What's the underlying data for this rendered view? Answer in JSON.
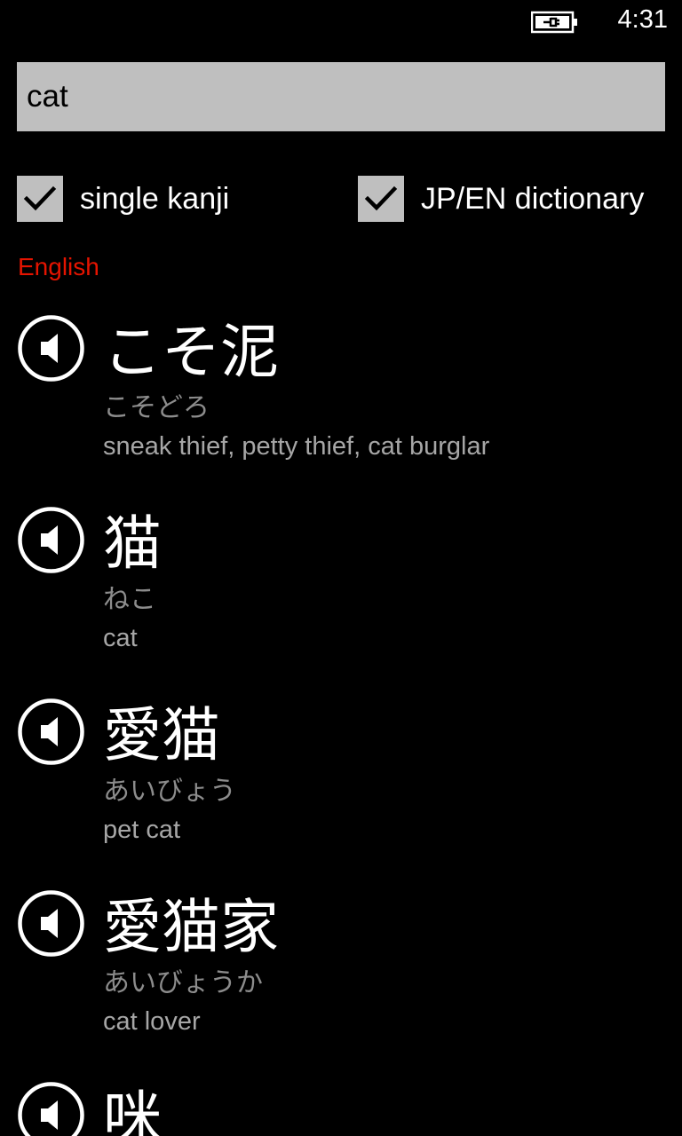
{
  "status_bar": {
    "battery_icon": "battery-charging-icon",
    "time": "4:31"
  },
  "search": {
    "value": "cat"
  },
  "options": {
    "single_kanji": {
      "label": "single kanji",
      "checked": true
    },
    "jp_en_dictionary": {
      "label": "JP/EN dictionary",
      "checked": true
    }
  },
  "section": {
    "title": "English",
    "accent_color": "#e51400"
  },
  "entries": [
    {
      "kanji": "こそ泥",
      "reading": "こそどろ",
      "meaning": "sneak thief, petty thief, cat burglar",
      "icon": "speaker-icon"
    },
    {
      "kanji": "猫",
      "reading": "ねこ",
      "meaning": "cat",
      "icon": "speaker-icon"
    },
    {
      "kanji": "愛猫",
      "reading": "あいびょう",
      "meaning": "pet cat",
      "icon": "speaker-icon"
    },
    {
      "kanji": "愛猫家",
      "reading": "あいびょうか",
      "meaning": "cat lover",
      "icon": "speaker-icon"
    },
    {
      "kanji": "咪",
      "reading": "",
      "meaning": "",
      "icon": "speaker-icon"
    }
  ]
}
